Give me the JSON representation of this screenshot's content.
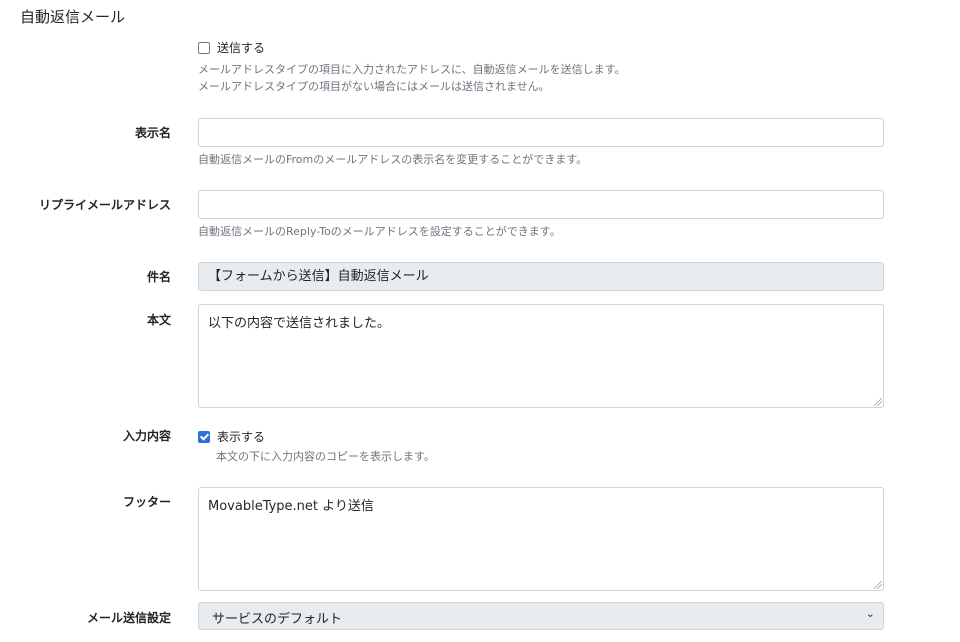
{
  "section_title": "自動返信メール",
  "send": {
    "checkbox_label": "送信する",
    "checked": false,
    "help_line1": "メールアドレスタイプの項目に入力されたアドレスに、自動返信メールを送信します。",
    "help_line2": "メールアドレスタイプの項目がない場合にはメールは送信されません。"
  },
  "display_name": {
    "label": "表示名",
    "value": "",
    "help": "自動返信メールのFromのメールアドレスの表示名を変更することができます。"
  },
  "reply_to": {
    "label": "リプライメールアドレス",
    "value": "",
    "help": "自動返信メールのReply-Toのメールアドレスを設定することができます。"
  },
  "subject": {
    "label": "件名",
    "value": "【フォームから送信】自動返信メール"
  },
  "body": {
    "label": "本文",
    "value": "以下の内容で送信されました。"
  },
  "input_content": {
    "label": "入力内容",
    "checkbox_label": "表示する",
    "checked": true,
    "help": "本文の下に入力内容のコピーを表示します。"
  },
  "footer": {
    "label": "フッター",
    "value": "MovableType.net より送信"
  },
  "mail_setting": {
    "label": "メール送信設定",
    "selected": "サービスのデフォルト"
  }
}
